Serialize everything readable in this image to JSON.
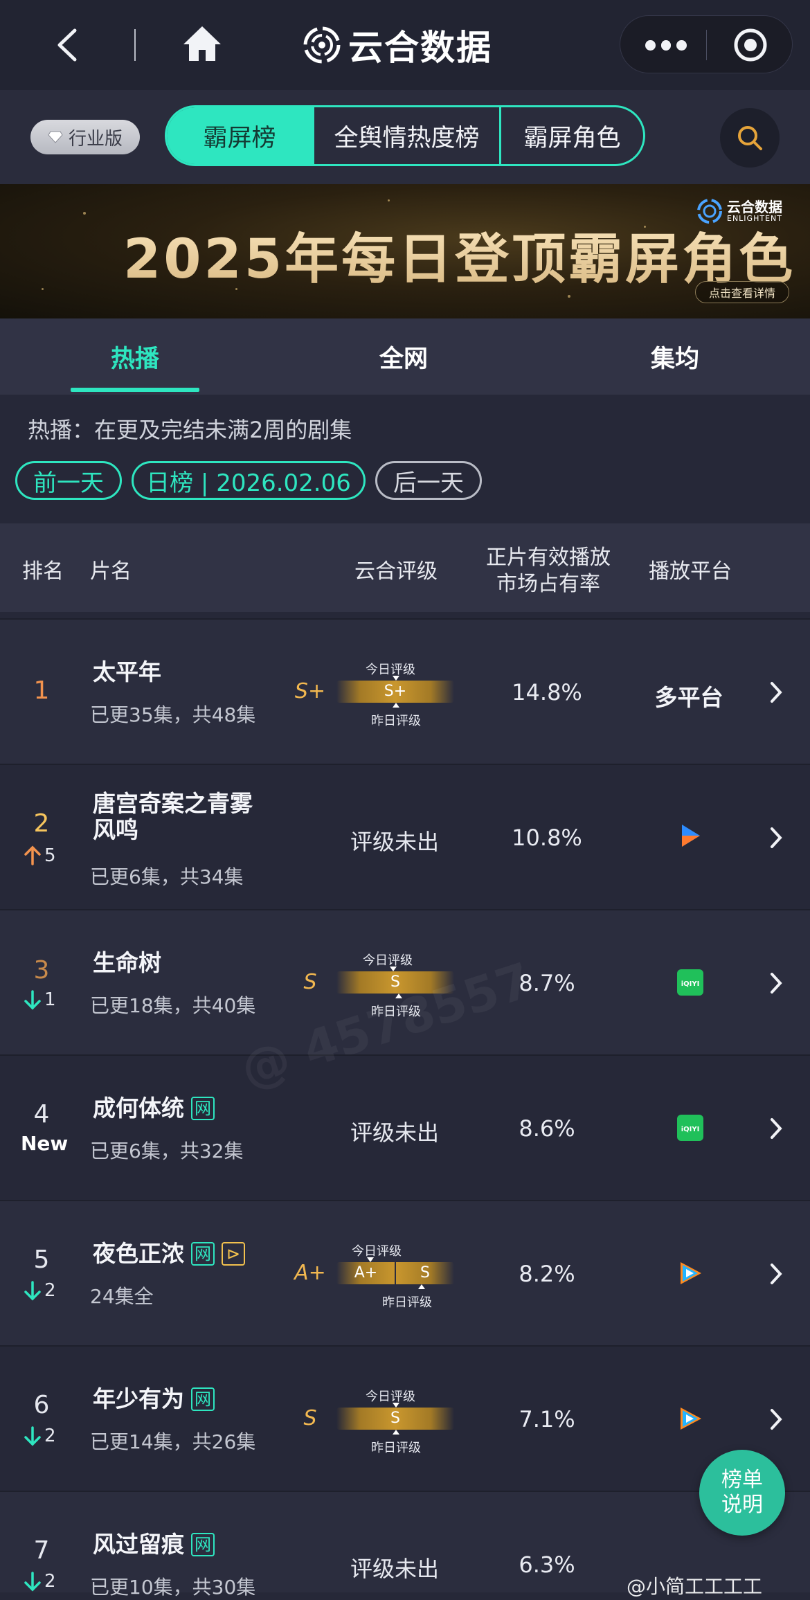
{
  "topbar": {
    "title": "云合数据",
    "back_icon": "chevron-left-icon",
    "home_icon": "home-icon",
    "more_icon": "more-dots-icon",
    "close_icon": "target-circle-icon"
  },
  "nav": {
    "edition_badge": "行业版",
    "segments": [
      "霸屏榜",
      "全舆情热度榜",
      "霸屏角色"
    ],
    "active_segment": 0,
    "search_icon": "search-icon"
  },
  "banner": {
    "title": "2025年每日登顶霸屏角色",
    "brand_cn": "云合数据",
    "brand_en": "ENLIGHTENT",
    "detail_button": "点击查看详情"
  },
  "tabs": [
    "热播",
    "全网",
    "集均"
  ],
  "active_tab": 0,
  "description": "热播：在更及完结未满2周的剧集",
  "date_controls": {
    "prev": "前一天",
    "current": "日榜 | 2026.02.06",
    "next": "后一天"
  },
  "table": {
    "headers": {
      "rank": "排名",
      "title": "片名",
      "rating": "云合评级",
      "share_line1": "正片有效播放",
      "share_line2": "市场占有率",
      "platform": "播放平台"
    },
    "grade_today_label": "今日评级",
    "grade_yesterday_label": "昨日评级",
    "rows": [
      {
        "rank": "1",
        "change": "",
        "title": "太平年",
        "title2": "",
        "tags": [],
        "sub": "已更35集，共48集",
        "grade": "S+",
        "today": "S+",
        "yesterday": "S+",
        "no_grade": "",
        "share": "14.8%",
        "platform": "多平台",
        "platform_icon": ""
      },
      {
        "rank": "2",
        "change": "5",
        "change_dir": "up",
        "title": "唐宫奇案之青雾",
        "title2": "风鸣",
        "tags": [],
        "sub": "已更6集，共34集",
        "grade": "",
        "no_grade": "评级未出",
        "share": "10.8%",
        "platform": "",
        "platform_icon": "youku-icon"
      },
      {
        "rank": "3",
        "change": "1",
        "change_dir": "down",
        "title": "生命树",
        "title2": "",
        "tags": [],
        "sub": "已更18集，共40集",
        "grade": "S",
        "today": "S",
        "yesterday": "S",
        "no_grade": "",
        "share": "8.7%",
        "platform": "",
        "platform_icon": "iqiyi-icon"
      },
      {
        "rank": "4",
        "change": "New",
        "change_dir": "new",
        "title": "成何体统",
        "title2": "",
        "tags": [
          "网"
        ],
        "sub": "已更6集，共32集",
        "grade": "",
        "no_grade": "评级未出",
        "share": "8.6%",
        "platform": "",
        "platform_icon": "iqiyi-icon"
      },
      {
        "rank": "5",
        "change": "2",
        "change_dir": "down",
        "title": "夜色正浓",
        "title2": "",
        "tags": [
          "网",
          "⊳"
        ],
        "sub": "24集全",
        "grade": "A+",
        "today": "A+",
        "yesterday": "S",
        "no_grade": "",
        "share": "8.2%",
        "platform": "",
        "platform_icon": "tencent-video-icon"
      },
      {
        "rank": "6",
        "change": "2",
        "change_dir": "down",
        "title": "年少有为",
        "title2": "",
        "tags": [
          "网"
        ],
        "sub": "已更14集，共26集",
        "grade": "S",
        "today": "S",
        "yesterday": "S",
        "no_grade": "",
        "share": "7.1%",
        "platform": "",
        "platform_icon": "tencent-video-icon"
      },
      {
        "rank": "7",
        "change": "2",
        "change_dir": "down",
        "title": "风过留痕",
        "title2": "",
        "tags": [
          "网"
        ],
        "sub": "已更10集，共30集",
        "grade": "",
        "no_grade": "评级未出",
        "share": "6.3%",
        "platform": "",
        "platform_icon": ""
      }
    ]
  },
  "fab": {
    "line1": "榜单",
    "line2": "说明"
  },
  "watermark": {
    "text": "@ 4578557",
    "weibo": "@小简工工工工"
  },
  "colors": {
    "accent": "#2ee6c0",
    "rank1": "#f3934e",
    "rank2": "#f6c55d",
    "grade": "#f2b850",
    "up": "#f3934e",
    "down": "#2ee6c0"
  }
}
